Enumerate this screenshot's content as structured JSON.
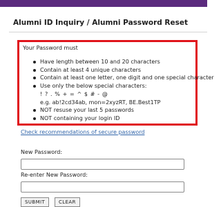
{
  "header": {
    "title": "Alumni ID Inquiry / Alumni Password Reset"
  },
  "rules": {
    "heading": "Your Password must",
    "items": [
      "Have length between 10 and 20 characters",
      "Contain at least 4 unique characters",
      "Contain at least one letter, one digit and one special character",
      "Use only the below special characters:",
      "NOT resuse your last 5 passwords",
      "NOT containing your login ID"
    ],
    "special_chars": "! ? . % + = ^ $ # - @",
    "example": "e.g. ab!2cd34ab, mon=2xyzRT, BE.Best1TP"
  },
  "recommend_link": "Check recommendations of secure password",
  "form": {
    "new_password_label": "New Password:",
    "new_password_value": "",
    "reenter_label": "Re-enter New Password:",
    "reenter_value": "",
    "submit_label": "Submit",
    "clear_label": "Clear"
  },
  "colors": {
    "accent_bar": "#5b2b7e",
    "rules_border": "#e0141b",
    "link": "#3366aa"
  }
}
